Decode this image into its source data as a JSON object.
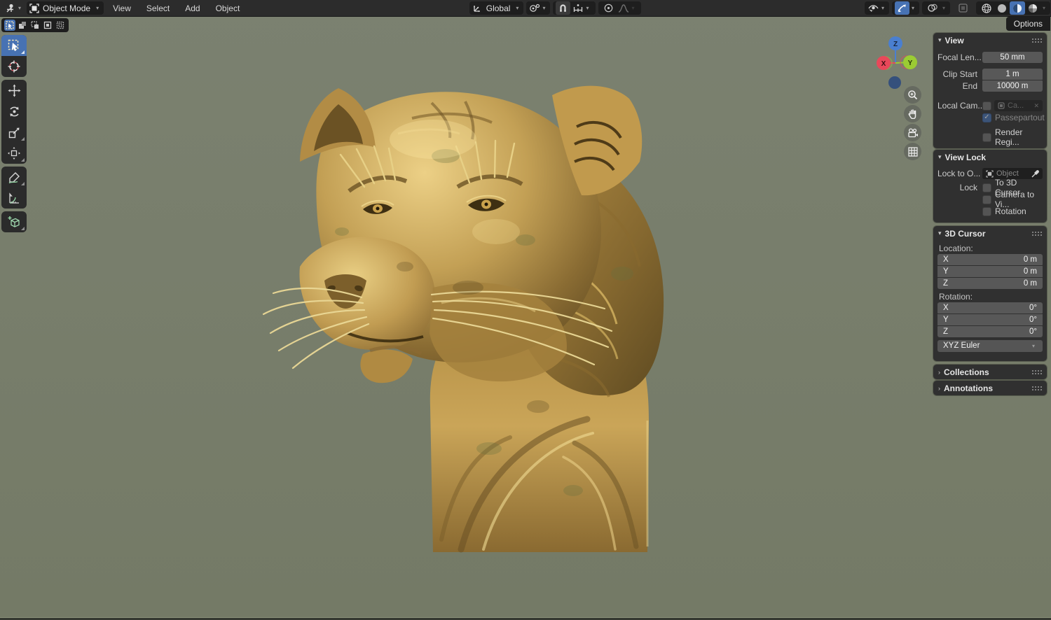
{
  "topbar": {
    "mode": "Object Mode",
    "menus": [
      "View",
      "Select",
      "Add",
      "Object"
    ],
    "orientation": "Global",
    "options_label": "Options"
  },
  "gizmo": {
    "x": "X",
    "y": "Y",
    "z": "Z"
  },
  "sidebar": {
    "view": {
      "title": "View",
      "focal_label": "Focal Len...",
      "focal_value": "50 mm",
      "clip_start_label": "Clip Start",
      "clip_start_value": "1 m",
      "clip_end_label": "End",
      "clip_end_value": "10000 m",
      "local_camera_label": "Local Cam...",
      "camera_value": "Ca...",
      "passepartout_label": "Passepartout",
      "render_region_label": "Render Regi..."
    },
    "view_lock": {
      "title": "View Lock",
      "lock_to_label": "Lock to O...",
      "object_placeholder": "Object",
      "lock_label": "Lock",
      "options": [
        "To 3D Cursor",
        "Camera to Vi...",
        "Rotation"
      ]
    },
    "cursor": {
      "title": "3D Cursor",
      "location_label": "Location:",
      "rotation_label": "Rotation:",
      "location": [
        {
          "axis": "X",
          "value": "0 m"
        },
        {
          "axis": "Y",
          "value": "0 m"
        },
        {
          "axis": "Z",
          "value": "0 m"
        }
      ],
      "rotation": [
        {
          "axis": "X",
          "value": "0°"
        },
        {
          "axis": "Y",
          "value": "0°"
        },
        {
          "axis": "Z",
          "value": "0°"
        }
      ],
      "euler_mode": "XYZ Euler"
    },
    "collections_title": "Collections",
    "annotations_title": "Annotations"
  },
  "icons": {
    "header_left": [
      "editor-type-icon",
      "object-mode-icon"
    ],
    "header_center": [
      "orientation-axis-icon",
      "pivot-point-icon",
      "magnet-icon",
      "snap-increment-icon",
      "proportional-editing-icon",
      "falloff-curve-icon"
    ],
    "header_right": [
      "eye-visibility-icon",
      "gizmo-toggle-icon",
      "overlays-icon",
      "xray-icon",
      "wireframe-icon",
      "solid-icon",
      "material-preview-icon",
      "rendered-icon"
    ],
    "toolbar": [
      "select-box-icon",
      "cursor-icon",
      "move-icon",
      "rotate-icon",
      "scale-icon",
      "transform-icon",
      "annotate-icon",
      "measure-icon",
      "add-cube-icon"
    ],
    "nav": [
      "zoom-icon",
      "pan-hand-icon",
      "camera-view-icon",
      "grid-toggle-icon"
    ]
  },
  "colors": {
    "accent": "#4772b3",
    "header_bg": "#2c2c2c",
    "panel_bg": "#303030",
    "field_bg": "#585858",
    "viewport_bg": "#777d6a",
    "axis_x": "#e8485a",
    "axis_y": "#9bcc33",
    "axis_z": "#4a7fd0",
    "gold": "#c9a452"
  }
}
